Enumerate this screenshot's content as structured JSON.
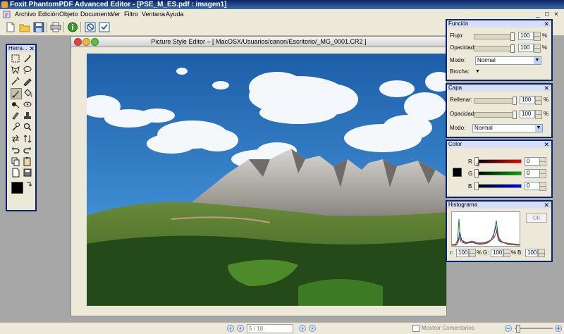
{
  "app": {
    "title": "Foxit PhantomPDF Advanced Editor - [PSE_M_ES.pdf : imagen1]",
    "window_controls": [
      "_",
      "□",
      "×"
    ]
  },
  "menu": [
    "Archivo",
    "Edición",
    "Objeto",
    "Documento",
    "Ver",
    "Filtro",
    "Ventana",
    "Ayuda"
  ],
  "toolbar": {
    "icons": [
      "new-doc-icon",
      "open-folder-icon",
      "save-icon",
      "print-icon",
      "info-icon",
      "no-entry-icon",
      "checkbox-icon"
    ]
  },
  "tools_panel": {
    "title": "Herra..."
  },
  "document": {
    "title": "Picture Style Editor – [ MacOSX/Usuarios/canon/Escritorio/_MG_0001.CR2 ]"
  },
  "funcion_panel": {
    "title": "Función",
    "flujo_label": "Flujo:",
    "flujo_value": "100",
    "opacidad_label": "Opacidad:",
    "opacidad_value": "100",
    "percent": "%",
    "modo_label": "Modo:",
    "modo_value": "Normal",
    "brocha_label": "Brocha:"
  },
  "capa_panel": {
    "title": "Capa",
    "rellenar_label": "Rellenar:",
    "rellenar_value": "100",
    "opacidad_label": "Opacidad:",
    "opacidad_value": "100",
    "percent": "%",
    "modo_label": "Modo:",
    "modo_value": "Normal"
  },
  "color_panel": {
    "title": "Color",
    "r_label": "R",
    "g_label": "G",
    "b_label": "B",
    "r_value": "0",
    "g_value": "0",
    "b_value": "0",
    "scale_min": "0"
  },
  "histograma_panel": {
    "title": "Histograma",
    "ok_label": "OK",
    "r_label": "r:",
    "r_value": "100",
    "g_label": "G:",
    "g_value": "100",
    "b_label": "B:",
    "b_value": "100",
    "percent": "%"
  },
  "statusbar": {
    "page": "5 / 18",
    "comments_label": "Mostrar Comentarios"
  },
  "colors": {
    "panel_border": "#0a246a",
    "panel_header": "#d6dff7",
    "workspace": "#a7a7a7",
    "chrome": "#ece9d8",
    "sky": "#2a6fb8"
  }
}
